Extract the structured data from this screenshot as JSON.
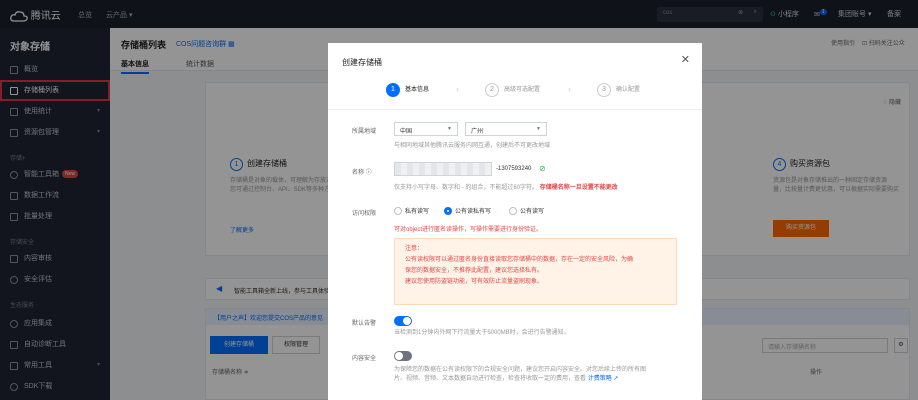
{
  "topbar": {
    "logo": "腾讯云",
    "nav": [
      "总览",
      "云产品"
    ],
    "search_placeholder": "cos",
    "mini_program": "小程序",
    "account": "集团账号",
    "mail_badge": "1",
    "lang": "备案"
  },
  "sidebar": {
    "title": "对象存储",
    "items": [
      {
        "label": "概览"
      },
      {
        "label": "存储桶列表"
      },
      {
        "label": "使用统计"
      },
      {
        "label": "资源包管理"
      }
    ],
    "groups": [
      "存储+",
      "存储安全",
      "生态服务"
    ],
    "items2": [
      {
        "label": "智能工具箱",
        "badge": "New"
      },
      {
        "label": "数据工作流"
      },
      {
        "label": "批量处理"
      }
    ],
    "items3": [
      {
        "label": "内容审核"
      },
      {
        "label": "安全评估"
      }
    ],
    "items4": [
      {
        "label": "应用集成"
      },
      {
        "label": "自动诊断工具"
      },
      {
        "label": "常用工具"
      },
      {
        "label": "SDK下载"
      }
    ]
  },
  "main": {
    "title": "存储桶列表",
    "subtitle": "COS问题咨询群",
    "tabs": [
      "基本信息",
      "统计数据"
    ],
    "right_links": [
      "使用指引",
      "扫码关注公众"
    ],
    "step1": {
      "num": "1",
      "title": "创建存储桶",
      "desc1": "存储桶是对象的载体，可理解为存放对象",
      "desc2": "您可通过控制台、API、SDK等多种方式"
    },
    "step4": {
      "num": "4",
      "title": "购买资源包",
      "desc1": "资源包是对象存储推出的一种固定存储资源",
      "desc2": "量，比按量计费更优惠，可以根据实际需要购买"
    },
    "learn_more": "了解更多",
    "buy_button": "购买资源包",
    "hide_label": "隐藏",
    "tool_notice": "智能工具箱全新上线，参与工具体验",
    "user_notice": "【用户之声】欢迎您提交COS产品的意见",
    "create_button": "创建存储桶",
    "perm_button": "权限管理",
    "table_search_placeholder": "请输入存储桶名称",
    "col_name": "存储桶名称 ≑",
    "col_action": "操作"
  },
  "modal": {
    "title": "创建存储桶",
    "steps": [
      {
        "num": "1",
        "label": "基本信息"
      },
      {
        "num": "2",
        "label": "高级可选配置"
      },
      {
        "num": "3",
        "label": "确认配置"
      }
    ],
    "region_label": "所属地域",
    "region_value": "中国",
    "city_value": "广州",
    "region_hint": "与相同地域其他腾讯云服务内网互通，创建后不可更改地域",
    "name_label": "名称",
    "name_suffix": "-1307593240",
    "name_hint": "仅支持小写字母、数字和 - 的组合，不能超过60字符。",
    "name_warning": "存储桶名称一旦设置不能更改",
    "access_label": "访问权限",
    "access_options": [
      "私有读写",
      "公有读私有写",
      "公有读写"
    ],
    "access_warning": "可对object进行匿名读操作，写操作需要进行身份验证。",
    "notice_lines": [
      "注意：",
      "公有读权限可以通过匿名身份直接读取您存储桶中的数据，存在一定的安全风险，为确",
      "保您的数据安全，不推荐此配置，建议您选择私有。",
      "建议您使用防盗链功能，可有效防止流量盗刷现象。"
    ],
    "alarm_label": "默认告警",
    "alarm_hint": "当检测到1分钟内外网下行流量大于5000MB时，会进行告警通知。",
    "content_label": "内容安全",
    "content_hint_1": "为保障您的数据在公有读权限下的合规安全问题，建议您开启内容安全。对您后续上传的所有图",
    "content_hint_2": "片、视频、音频、文本数据自动进行检查，检查将收取一定的费用，查看",
    "pricing_link": "计费策略"
  }
}
